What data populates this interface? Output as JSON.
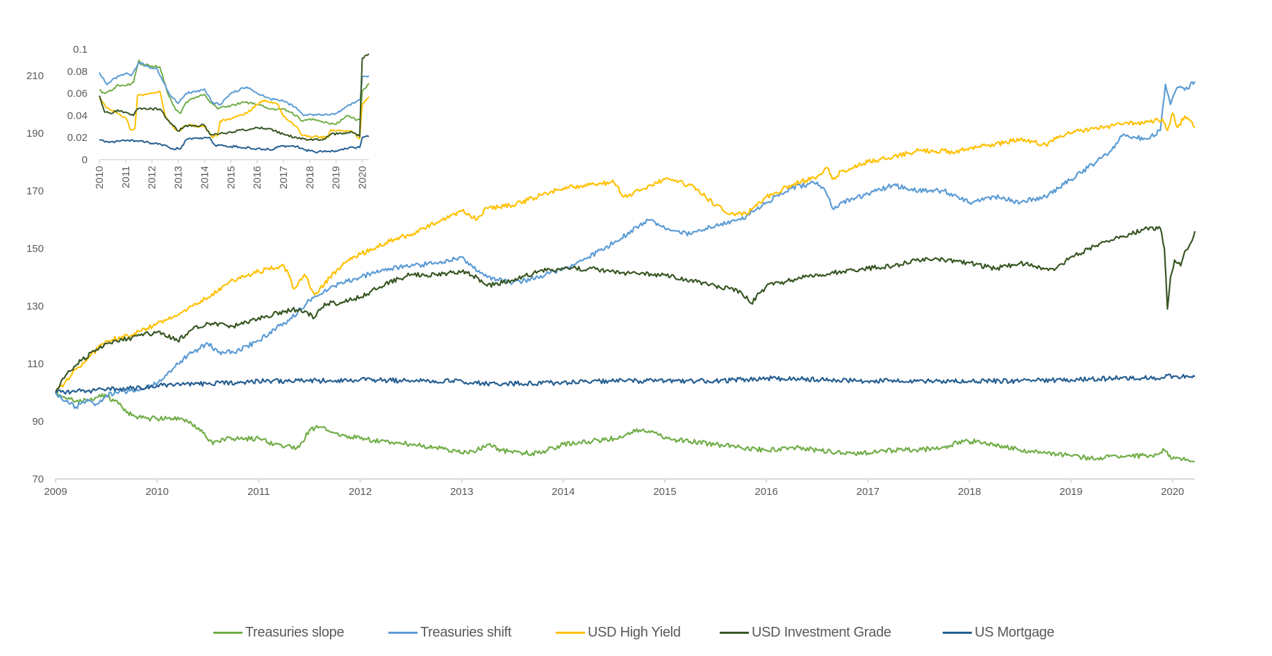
{
  "chart_data": [
    {
      "id": "main",
      "type": "line",
      "title": "",
      "xlabel": "",
      "ylabel": "",
      "xlim": [
        2009,
        2020.22
      ],
      "ylim": [
        70,
        210
      ],
      "x_ticks": [
        "2009",
        "2010",
        "2011",
        "2012",
        "2013",
        "2014",
        "2015",
        "2016",
        "2017",
        "2018",
        "2019",
        "2020"
      ],
      "y_ticks": [
        "70",
        "90",
        "110",
        "130",
        "150",
        "170",
        "190",
        "210"
      ],
      "grid": false,
      "legend_position": "bottom",
      "series": [
        {
          "name": "Treasuries slope",
          "color": "#70AD47",
          "x": [
            2009,
            2009.1,
            2009.2,
            2009.35,
            2009.5,
            2009.62,
            2009.75,
            2009.9,
            2010,
            2010.15,
            2010.3,
            2010.45,
            2010.55,
            2010.65,
            2010.75,
            2011,
            2011.15,
            2011.25,
            2011.4,
            2011.5,
            2011.6,
            2011.75,
            2012,
            2012.25,
            2012.5,
            2012.75,
            2013,
            2013.15,
            2013.25,
            2013.4,
            2013.5,
            2013.75,
            2014,
            2014.25,
            2014.5,
            2014.75,
            2014.9,
            2015,
            2015.25,
            2015.5,
            2015.75,
            2016,
            2016.25,
            2016.5,
            2016.75,
            2017,
            2017.25,
            2017.5,
            2017.75,
            2017.9,
            2018.1,
            2018.25,
            2018.5,
            2018.75,
            2019,
            2019.25,
            2019.4,
            2019.6,
            2019.8,
            2019.92,
            2020,
            2020.1,
            2020.22
          ],
          "values": [
            100,
            98,
            97,
            98,
            99,
            96,
            92,
            91,
            91,
            91,
            90,
            86,
            82,
            84,
            84,
            84,
            82,
            81,
            81,
            87,
            88,
            86,
            84,
            83,
            82,
            81,
            79,
            80,
            82,
            80,
            79,
            79,
            82,
            83,
            84,
            87,
            86,
            84,
            83,
            82,
            81,
            80,
            81,
            80,
            79,
            79,
            80,
            80,
            81,
            83,
            83,
            82,
            80,
            79,
            78,
            77,
            78,
            78,
            78,
            80,
            77,
            77,
            76
          ]
        },
        {
          "name": "Treasuries shift",
          "color": "#5B9BD5",
          "x": [
            2009,
            2009.1,
            2009.2,
            2009.3,
            2009.4,
            2009.5,
            2009.6,
            2009.8,
            2010,
            2010.15,
            2010.3,
            2010.5,
            2010.6,
            2010.75,
            2011,
            2011.15,
            2011.3,
            2011.5,
            2011.6,
            2011.75,
            2012,
            2012.25,
            2012.5,
            2012.75,
            2013,
            2013.1,
            2013.25,
            2013.5,
            2013.75,
            2014,
            2014.25,
            2014.5,
            2014.75,
            2014.85,
            2015,
            2015.25,
            2015.5,
            2015.75,
            2016,
            2016.25,
            2016.5,
            2016.58,
            2016.65,
            2016.75,
            2017,
            2017.25,
            2017.5,
            2017.75,
            2018,
            2018.25,
            2018.5,
            2018.75,
            2019,
            2019.25,
            2019.4,
            2019.5,
            2019.75,
            2019.88,
            2019.93,
            2019.98,
            2020.05,
            2020.12,
            2020.22
          ],
          "values": [
            100,
            97,
            95,
            97,
            96,
            99,
            100,
            101,
            103,
            108,
            113,
            117,
            114,
            114,
            118,
            122,
            125,
            132,
            134,
            137,
            140,
            143,
            144,
            145,
            147,
            144,
            140,
            138,
            140,
            143,
            147,
            152,
            158,
            160,
            157,
            155,
            158,
            160,
            166,
            171,
            173,
            170,
            164,
            166,
            169,
            172,
            170,
            170,
            166,
            168,
            166,
            168,
            174,
            180,
            184,
            189,
            188,
            191,
            207,
            200,
            206,
            205,
            208
          ]
        },
        {
          "name": "USD High Yield",
          "color": "#FFC000",
          "x": [
            2009,
            2009.1,
            2009.2,
            2009.35,
            2009.5,
            2009.75,
            2010,
            2010.15,
            2010.3,
            2010.5,
            2010.75,
            2011,
            2011.25,
            2011.35,
            2011.45,
            2011.55,
            2011.7,
            2011.85,
            2012,
            2012.25,
            2012.5,
            2012.75,
            2013,
            2013.15,
            2013.25,
            2013.5,
            2013.75,
            2014,
            2014.25,
            2014.5,
            2014.6,
            2014.75,
            2015,
            2015.25,
            2015.4,
            2015.5,
            2015.65,
            2015.8,
            2016,
            2016.25,
            2016.5,
            2016.6,
            2016.65,
            2016.75,
            2017,
            2017.25,
            2017.5,
            2017.75,
            2017.85,
            2018,
            2018.25,
            2018.5,
            2018.75,
            2018.85,
            2019,
            2019.25,
            2019.5,
            2019.75,
            2019.9,
            2019.95,
            2020,
            2020.05,
            2020.12,
            2020.22
          ],
          "values": [
            100,
            104,
            108,
            113,
            118,
            120,
            124,
            126,
            129,
            133,
            139,
            142,
            144,
            136,
            141,
            134,
            140,
            145,
            148,
            152,
            155,
            159,
            163,
            160,
            164,
            165,
            168,
            171,
            172,
            173,
            168,
            170,
            174,
            172,
            168,
            165,
            162,
            162,
            168,
            172,
            175,
            178,
            174,
            177,
            180,
            182,
            184,
            184,
            183,
            185,
            186,
            188,
            186,
            188,
            190,
            192,
            193,
            194,
            195,
            191,
            197,
            192,
            196,
            192
          ]
        },
        {
          "name": "USD Investment Grade",
          "color": "#375623",
          "x": [
            2009,
            2009.1,
            2009.25,
            2009.4,
            2009.5,
            2009.75,
            2010,
            2010.2,
            2010.35,
            2010.5,
            2010.75,
            2011,
            2011.25,
            2011.4,
            2011.55,
            2011.65,
            2011.75,
            2012,
            2012.25,
            2012.5,
            2012.75,
            2013,
            2013.15,
            2013.25,
            2013.5,
            2013.75,
            2014,
            2014.25,
            2014.5,
            2014.75,
            2015,
            2015.25,
            2015.5,
            2015.75,
            2015.85,
            2016,
            2016.25,
            2016.5,
            2016.75,
            2017,
            2017.25,
            2017.5,
            2017.75,
            2018,
            2018.25,
            2018.5,
            2018.75,
            2018.85,
            2019,
            2019.25,
            2019.5,
            2019.75,
            2019.88,
            2019.92,
            2019.95,
            2019.98,
            2020.02,
            2020.08,
            2020.12,
            2020.18,
            2020.22
          ],
          "values": [
            100,
            106,
            111,
            115,
            117,
            119,
            121,
            118,
            122,
            124,
            123,
            126,
            128,
            129,
            126,
            131,
            131,
            133,
            138,
            141,
            141,
            142,
            140,
            137,
            139,
            142,
            143,
            143,
            142,
            141,
            141,
            139,
            137,
            135,
            131,
            137,
            139,
            141,
            142,
            143,
            144,
            146,
            146,
            145,
            143,
            145,
            143,
            143,
            147,
            151,
            154,
            157,
            157,
            150,
            129,
            140,
            146,
            144,
            149,
            152,
            156
          ]
        },
        {
          "name": "US Mortgage",
          "color": "#255E91",
          "x": [
            2009,
            2009.25,
            2009.5,
            2009.75,
            2010,
            2010.5,
            2011,
            2011.5,
            2012,
            2012.5,
            2013,
            2013.25,
            2013.5,
            2014,
            2014.5,
            2015,
            2015.5,
            2016,
            2016.5,
            2017,
            2017.5,
            2018,
            2018.5,
            2019,
            2019.5,
            2019.9,
            2019.95,
            2020.05,
            2020.22
          ],
          "values": [
            100,
            100.5,
            101,
            101.5,
            102.5,
            103,
            104,
            104,
            104.5,
            104,
            104,
            103,
            103,
            103.5,
            104,
            104,
            104,
            105,
            104.5,
            104,
            104,
            104,
            104,
            104.5,
            105,
            105.2,
            106,
            105.5,
            105.5
          ]
        }
      ]
    },
    {
      "id": "inset",
      "type": "line",
      "title": "",
      "xlim": [
        2010,
        2020.25
      ],
      "ylim": [
        0,
        0.1
      ],
      "x_ticks": [
        "2010",
        "2011",
        "2012",
        "2013",
        "2014",
        "2015",
        "2016",
        "2017",
        "2018",
        "2019",
        "2020"
      ],
      "y_ticks": [
        "0",
        "0.02",
        "0.04",
        "0.06",
        "0.08",
        "0.1"
      ],
      "grid": false,
      "series": [
        {
          "name": "Treasuries slope",
          "color": "#70AD47",
          "x": [
            2010,
            2010.2,
            2010.5,
            2010.7,
            2011,
            2011.3,
            2011.5,
            2011.6,
            2012,
            2012.3,
            2012.6,
            2012.9,
            2013.1,
            2013.3,
            2013.7,
            2014,
            2014.2,
            2014.5,
            2015,
            2015.5,
            2016,
            2016.5,
            2017,
            2017.5,
            2017.7,
            2018,
            2018.5,
            2019,
            2019.4,
            2019.8,
            2019.92,
            2020,
            2020.25
          ],
          "values": [
            0.063,
            0.06,
            0.063,
            0.068,
            0.067,
            0.07,
            0.09,
            0.086,
            0.085,
            0.084,
            0.06,
            0.045,
            0.042,
            0.052,
            0.057,
            0.059,
            0.052,
            0.046,
            0.049,
            0.052,
            0.05,
            0.046,
            0.046,
            0.04,
            0.035,
            0.037,
            0.034,
            0.032,
            0.04,
            0.036,
            0.036,
            0.062,
            0.069
          ]
        },
        {
          "name": "Treasuries shift",
          "color": "#5B9BD5",
          "x": [
            2010,
            2010.3,
            2010.6,
            2011,
            2011.2,
            2011.5,
            2012,
            2012.2,
            2012.4,
            2012.7,
            2013,
            2013.3,
            2013.7,
            2014,
            2014.3,
            2014.6,
            2015,
            2015.6,
            2016,
            2016.5,
            2017,
            2017.5,
            2017.8,
            2018.2,
            2018.8,
            2019,
            2019.4,
            2019.8,
            2019.92,
            2020,
            2020.25
          ],
          "values": [
            0.079,
            0.068,
            0.074,
            0.078,
            0.076,
            0.088,
            0.083,
            0.082,
            0.072,
            0.058,
            0.051,
            0.06,
            0.062,
            0.064,
            0.052,
            0.05,
            0.06,
            0.066,
            0.06,
            0.055,
            0.053,
            0.047,
            0.04,
            0.041,
            0.041,
            0.042,
            0.048,
            0.053,
            0.054,
            0.075,
            0.076
          ]
        },
        {
          "name": "USD High Yield",
          "color": "#FFC000",
          "x": [
            2010,
            2010.3,
            2010.7,
            2011,
            2011.2,
            2011.35,
            2011.45,
            2012,
            2012.3,
            2012.5,
            2012.8,
            2013,
            2013.3,
            2014,
            2014.3,
            2014.5,
            2014.6,
            2015,
            2015.6,
            2016,
            2016.3,
            2016.8,
            2017,
            2017.5,
            2017.7,
            2018,
            2018.7,
            2018.8,
            2019,
            2019.6,
            2019.9,
            2020,
            2020.25
          ],
          "values": [
            0.055,
            0.047,
            0.042,
            0.038,
            0.027,
            0.028,
            0.058,
            0.06,
            0.062,
            0.04,
            0.03,
            0.026,
            0.031,
            0.03,
            0.02,
            0.022,
            0.035,
            0.037,
            0.042,
            0.05,
            0.054,
            0.05,
            0.039,
            0.03,
            0.022,
            0.021,
            0.02,
            0.027,
            0.026,
            0.026,
            0.019,
            0.05,
            0.057
          ]
        },
        {
          "name": "USD Investment Grade",
          "color": "#375623",
          "x": [
            2010,
            2010.2,
            2010.5,
            2010.7,
            2011,
            2011.3,
            2011.45,
            2012,
            2012.3,
            2012.6,
            2013,
            2013.3,
            2014,
            2014.2,
            2014.5,
            2015,
            2015.5,
            2016,
            2016.5,
            2017,
            2017.5,
            2018,
            2018.5,
            2018.8,
            2019.3,
            2019.6,
            2019.9,
            2019.95,
            2020,
            2020.25
          ],
          "values": [
            0.058,
            0.043,
            0.042,
            0.045,
            0.043,
            0.04,
            0.046,
            0.046,
            0.046,
            0.036,
            0.026,
            0.031,
            0.031,
            0.023,
            0.023,
            0.025,
            0.027,
            0.029,
            0.028,
            0.023,
            0.02,
            0.018,
            0.018,
            0.023,
            0.024,
            0.025,
            0.021,
            0.06,
            0.092,
            0.096
          ]
        },
        {
          "name": "US Mortgage",
          "color": "#255E91",
          "x": [
            2010,
            2010.2,
            2011,
            2011.6,
            2012,
            2012.5,
            2012.8,
            2013.1,
            2013.3,
            2014,
            2014.2,
            2014.4,
            2015,
            2016,
            2016.6,
            2016.8,
            2017.5,
            2017.8,
            2018.2,
            2019,
            2019.5,
            2019.9,
            2020,
            2020.25
          ],
          "values": [
            0.018,
            0.016,
            0.017,
            0.017,
            0.015,
            0.013,
            0.01,
            0.01,
            0.018,
            0.02,
            0.02,
            0.013,
            0.012,
            0.01,
            0.009,
            0.012,
            0.012,
            0.009,
            0.007,
            0.008,
            0.011,
            0.011,
            0.02,
            0.021
          ]
        }
      ]
    }
  ],
  "legend": [
    {
      "label": "Treasuries slope",
      "color": "#70AD47"
    },
    {
      "label": "Treasuries shift",
      "color": "#5B9BD5"
    },
    {
      "label": "USD High Yield",
      "color": "#FFC000"
    },
    {
      "label": "USD Investment Grade",
      "color": "#375623"
    },
    {
      "label": "US Mortgage",
      "color": "#255E91"
    }
  ]
}
